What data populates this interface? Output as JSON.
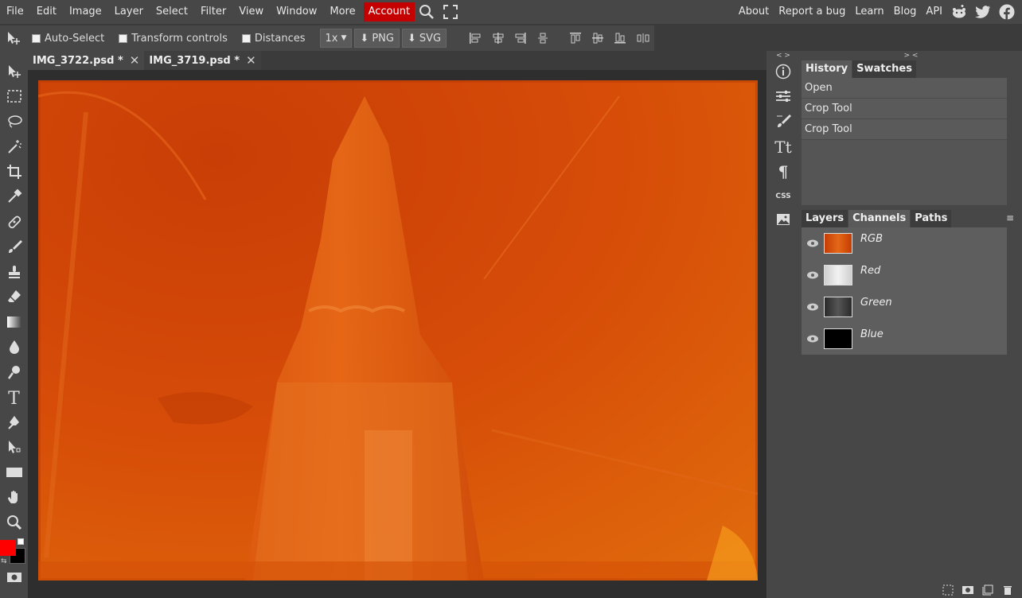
{
  "menu": {
    "items": [
      "File",
      "Edit",
      "Image",
      "Layer",
      "Select",
      "Filter",
      "View",
      "Window",
      "More"
    ],
    "account": "Account",
    "right_links": [
      "About",
      "Report a bug",
      "Learn",
      "Blog",
      "API"
    ]
  },
  "options": {
    "auto_select": "Auto-Select",
    "transform_controls": "Transform controls",
    "distances": "Distances",
    "zoom": "1x",
    "png": "PNG",
    "svg": "SVG"
  },
  "tabs": [
    {
      "label": "IMG_3722.psd *",
      "active": true
    },
    {
      "label": "IMG_3719.psd *",
      "active": false
    }
  ],
  "collapse_left": "> <",
  "collapse_mid": "< >",
  "collapse_right": "> <",
  "history_panel": {
    "tabs": [
      "History",
      "Swatches"
    ],
    "rows": [
      "Open",
      "Crop Tool",
      "Crop Tool"
    ]
  },
  "layers_panel": {
    "tabs": [
      "Layers",
      "Channels",
      "Paths"
    ],
    "channels": [
      {
        "label": "RGB",
        "thumb_color": "#d85000"
      },
      {
        "label": "Red",
        "thumb_color": "#d8d8d8"
      },
      {
        "label": "Green",
        "thumb_color": "#3a3a3a"
      },
      {
        "label": "Blue",
        "thumb_color": "#000000"
      }
    ]
  },
  "colors": {
    "foreground": "#ff0000",
    "background": "#000000",
    "accent": "#c40000"
  },
  "mid_css": "CSS"
}
